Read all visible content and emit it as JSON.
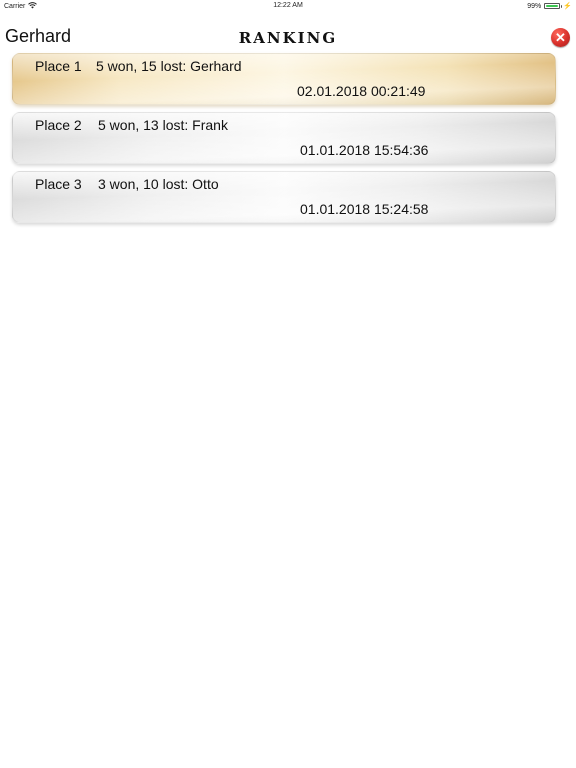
{
  "status_bar": {
    "carrier": "Carrier",
    "time": "12:22 AM",
    "battery_percent": "99%",
    "battery_level": 0.99,
    "icons": [
      "wifi-icon",
      "battery-icon",
      "charging-icon"
    ]
  },
  "header": {
    "player_name": "Gerhard",
    "title": "RANKING",
    "close_icon": "close-icon",
    "close_color": "#d8302b"
  },
  "ranking": [
    {
      "place": "Place 1",
      "result": "5 won, 15 lost: Gerhard",
      "date": "02.01.2018 00:21:49",
      "highlight_color": "#f4e2b6"
    },
    {
      "place": "Place 2",
      "result": "5 won, 13 lost: Frank",
      "date": "01.01.2018 15:54:36"
    },
    {
      "place": "Place 3",
      "result": "3 won, 10 lost: Otto",
      "date": "01.01.2018 15:24:58"
    }
  ]
}
